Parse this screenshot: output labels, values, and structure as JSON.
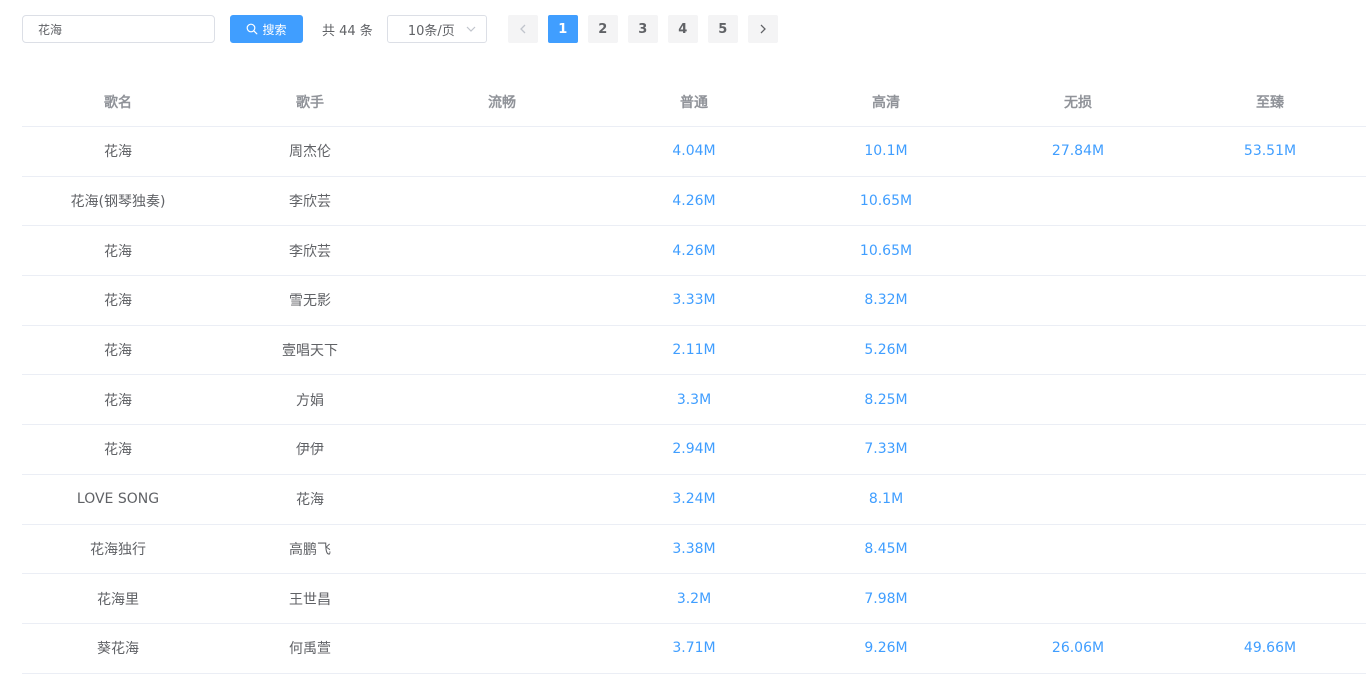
{
  "search": {
    "value": "花海",
    "button_label": "搜索"
  },
  "pagination": {
    "total_text": "共 44 条",
    "page_size": "10条/页",
    "pages": [
      "1",
      "2",
      "3",
      "4",
      "5"
    ],
    "current_page": "1"
  },
  "table": {
    "columns": [
      "歌名",
      "歌手",
      "流畅",
      "普通",
      "高清",
      "无损",
      "至臻"
    ],
    "rows": [
      {
        "title": "花海",
        "artist": "周杰伦",
        "smooth": "",
        "normal": "4.04M",
        "hd": "10.1M",
        "lossless": "27.84M",
        "master": "53.51M"
      },
      {
        "title": "花海(钢琴独奏)",
        "artist": "李欣芸",
        "smooth": "",
        "normal": "4.26M",
        "hd": "10.65M",
        "lossless": "",
        "master": ""
      },
      {
        "title": "花海",
        "artist": "李欣芸",
        "smooth": "",
        "normal": "4.26M",
        "hd": "10.65M",
        "lossless": "",
        "master": ""
      },
      {
        "title": "花海",
        "artist": "雪无影",
        "smooth": "",
        "normal": "3.33M",
        "hd": "8.32M",
        "lossless": "",
        "master": ""
      },
      {
        "title": "花海",
        "artist": "壹唱天下",
        "smooth": "",
        "normal": "2.11M",
        "hd": "5.26M",
        "lossless": "",
        "master": ""
      },
      {
        "title": "花海",
        "artist": "方娟",
        "smooth": "",
        "normal": "3.3M",
        "hd": "8.25M",
        "lossless": "",
        "master": ""
      },
      {
        "title": "花海",
        "artist": "伊伊",
        "smooth": "",
        "normal": "2.94M",
        "hd": "7.33M",
        "lossless": "",
        "master": ""
      },
      {
        "title": "LOVE SONG",
        "artist": "花海",
        "smooth": "",
        "normal": "3.24M",
        "hd": "8.1M",
        "lossless": "",
        "master": ""
      },
      {
        "title": "花海独行",
        "artist": "高鹏飞",
        "smooth": "",
        "normal": "3.38M",
        "hd": "8.45M",
        "lossless": "",
        "master": ""
      },
      {
        "title": "花海里",
        "artist": "王世昌",
        "smooth": "",
        "normal": "3.2M",
        "hd": "7.98M",
        "lossless": "",
        "master": ""
      },
      {
        "title": "葵花海",
        "artist": "何禹萱",
        "smooth": "",
        "normal": "3.71M",
        "hd": "9.26M",
        "lossless": "26.06M",
        "master": "49.66M"
      }
    ]
  },
  "colors": {
    "accent": "#409eff",
    "text": "#606266",
    "header_text": "#909399",
    "border": "#ebeef5"
  }
}
